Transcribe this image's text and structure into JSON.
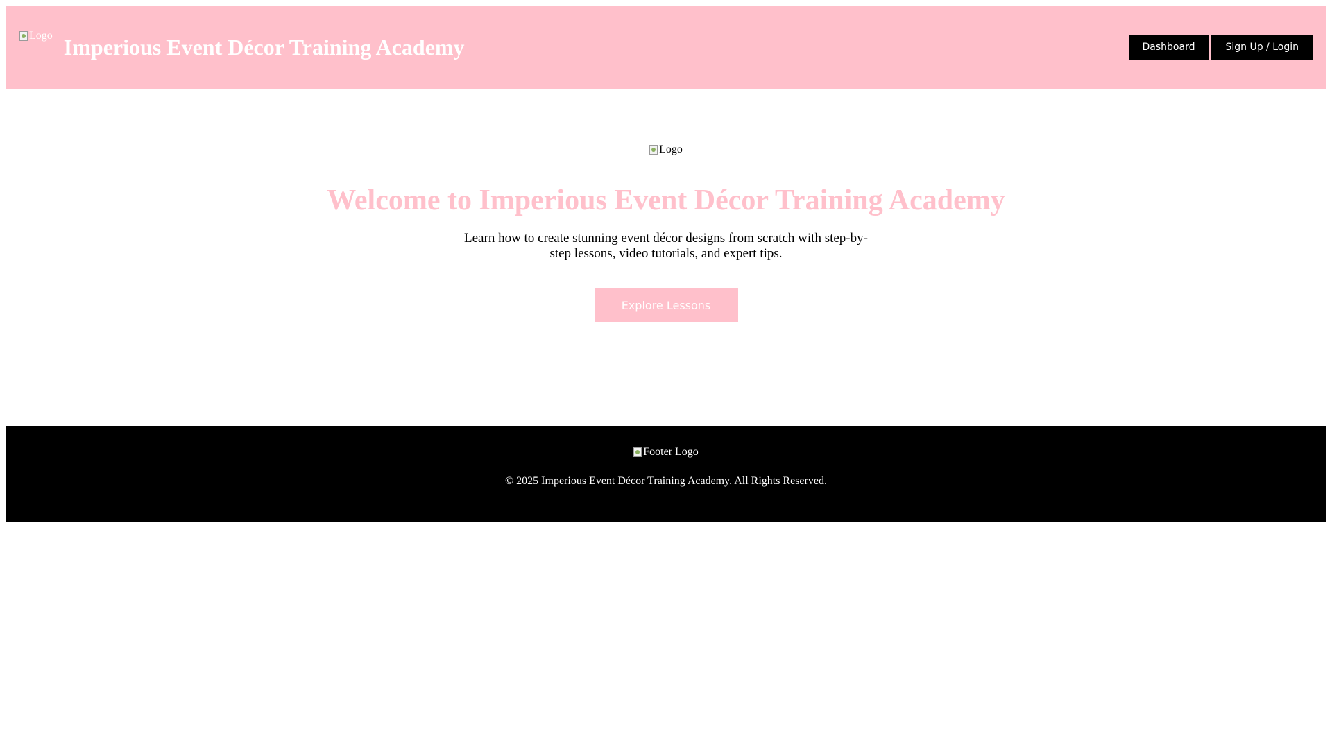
{
  "colors": {
    "brand_pink": "#ffc0cb",
    "black": "#000000",
    "white": "#ffffff"
  },
  "header": {
    "logo_alt": "Logo",
    "site_title": "Imperious Event Décor Training Academy",
    "nav": {
      "dashboard_label": "Dashboard",
      "signup_login_label": "Sign Up / Login"
    }
  },
  "hero": {
    "logo_alt": "Logo",
    "title": "Welcome to Imperious Event Décor Training Academy",
    "description": "Learn how to create stunning event décor designs from scratch with step-by-step lessons, video tutorials, and expert tips.",
    "cta_label": "Explore Lessons"
  },
  "footer": {
    "logo_alt": "Footer Logo",
    "copyright": "© 2025 Imperious Event Décor Training Academy. All Rights Reserved."
  },
  "icons": {
    "broken_image": "broken-image-icon"
  }
}
